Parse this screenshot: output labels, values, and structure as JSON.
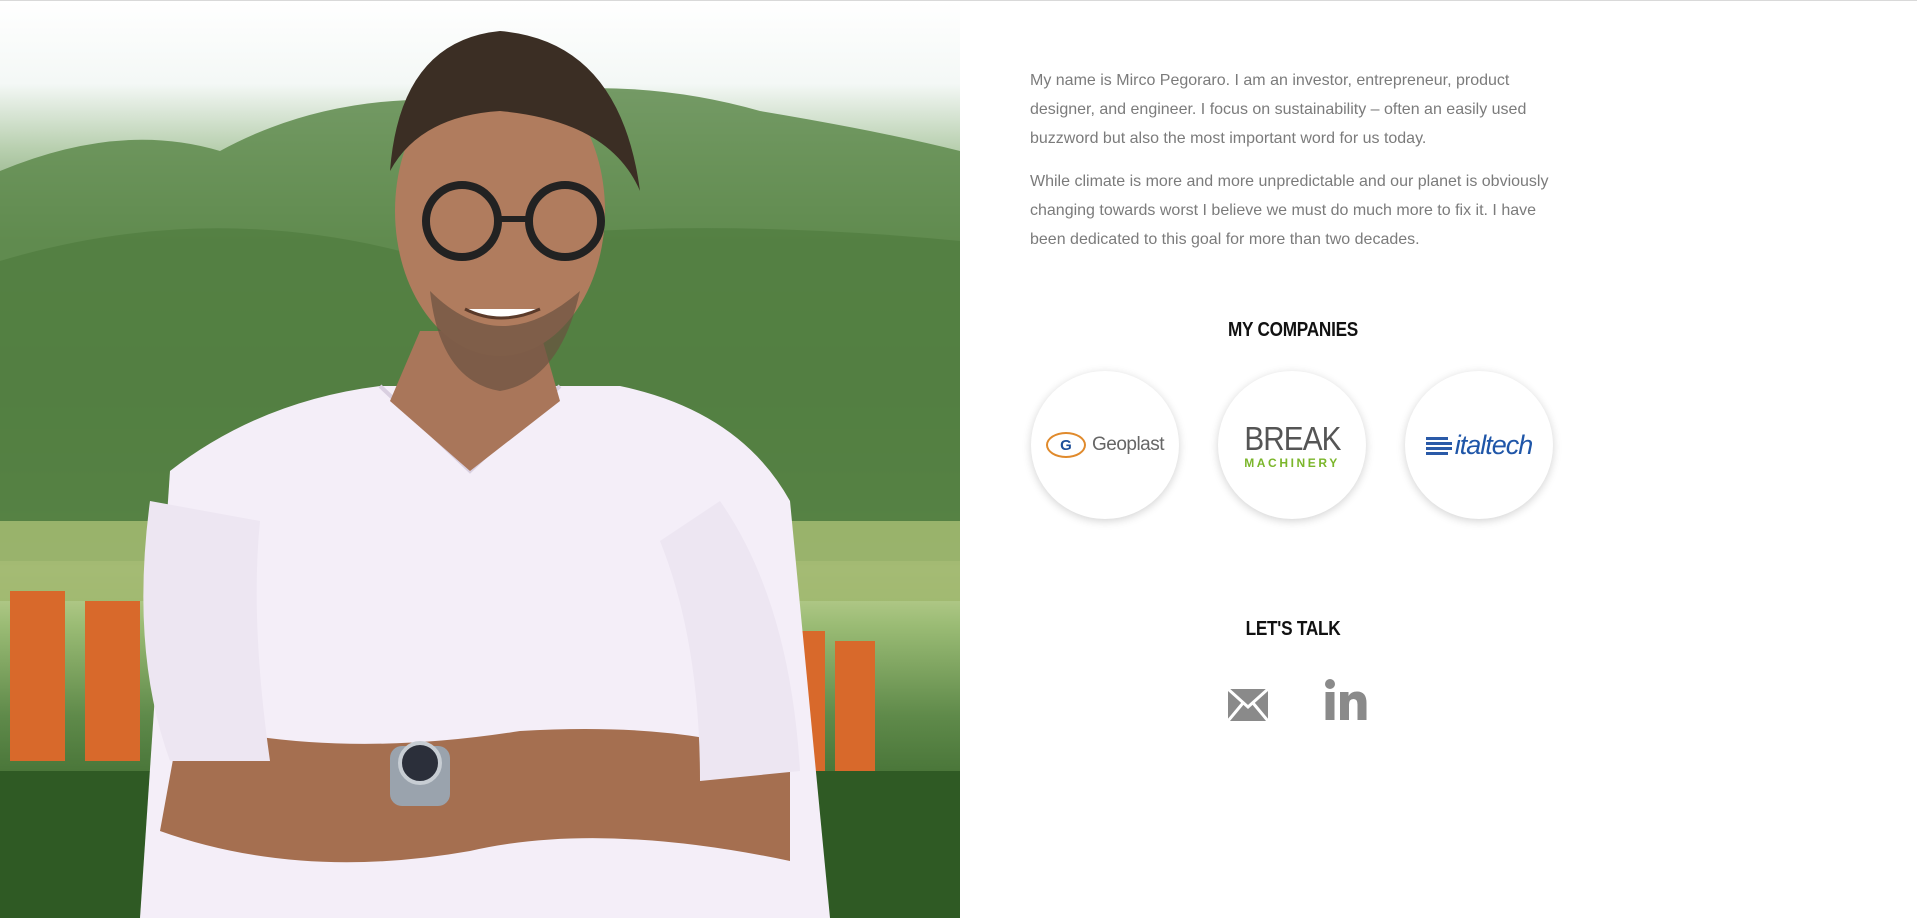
{
  "bio": {
    "paragraph1": "My name is Mirco Pegoraro. I am an investor, entrepreneur, product designer, and engineer. I focus on sustainability – often an easily used buzzword but also the most important word for us today.",
    "paragraph2": "While climate is more and more unpredictable and our planet is obviously changing towards worst I believe we must do much more to fix it. I have been dedicated to this goal for more than two decades."
  },
  "companies": {
    "title": "MY COMPANIES",
    "items": [
      {
        "mark": "G",
        "label": "Geoplast"
      },
      {
        "line1": "BREAK",
        "line2": "MACHINERY"
      },
      {
        "label": "italtech"
      }
    ]
  },
  "contact": {
    "title": "LET'S TALK",
    "icons": [
      "mail-icon",
      "linkedin-icon"
    ]
  },
  "colors": {
    "text": "#7b7b7b",
    "heading": "#111111",
    "icon": "#8a8a8a",
    "break_green": "#7bb62b",
    "italtech_blue": "#1f56a8"
  }
}
